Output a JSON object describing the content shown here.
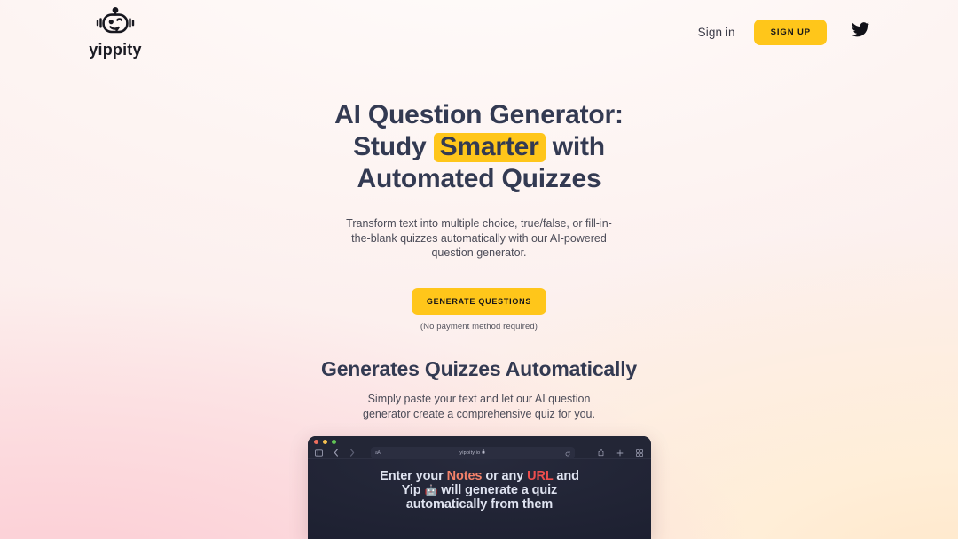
{
  "brand": {
    "name": "yippity",
    "logo_icon": "robot-head-icon"
  },
  "header": {
    "signin_label": "Sign in",
    "signup_label": "SIGN UP",
    "twitter_icon": "twitter-bird-icon",
    "signup_color": "#ffc61a"
  },
  "hero": {
    "title_line1": "AI Question Generator:",
    "title_line2_pre": "Study ",
    "title_line2_highlight": "Smarter",
    "title_line2_post": " with",
    "title_line3": "Automated Quizzes",
    "highlight_color": "#ffc61a",
    "title_color": "#333a52",
    "subtitle": "Transform text into multiple choice, true/false, or fill-in-the-blank quizzes automatically with our AI-powered question generator.",
    "cta_label": "GENERATE QUESTIONS",
    "cta_note": "(No payment method required)"
  },
  "section2": {
    "title": "Generates Quizzes Automatically",
    "subtitle": "Simply paste your text and let our AI question generator create a comprehensive quiz for you."
  },
  "browser": {
    "traffic_lights": [
      "close-red",
      "minimize-yellow",
      "maximize-green"
    ],
    "sidebar_icon": "sidebar-toggle-icon",
    "back_icon": "chevron-left-icon",
    "forward_icon": "chevron-right-icon",
    "text_size_icon": "aA-text-size-icon",
    "url": "yippity.io",
    "lock_icon": "lock-icon",
    "reload_icon": "reload-icon",
    "share_icon": "share-icon",
    "new_tab_icon": "plus-icon",
    "tab_overview_icon": "tab-overview-icon",
    "content": {
      "line1_pre": "Enter your ",
      "line1_notes": "Notes",
      "line1_post": " or any",
      "line2_url": "URL",
      "line2_mid": " and Yip ",
      "line2_emoji": "🤖",
      "line2_post": " will",
      "line3": "generate a quiz",
      "line4": "automatically from",
      "line5": "them",
      "notes_color": "#f4826a",
      "url_color": "#ed4e4e"
    }
  }
}
